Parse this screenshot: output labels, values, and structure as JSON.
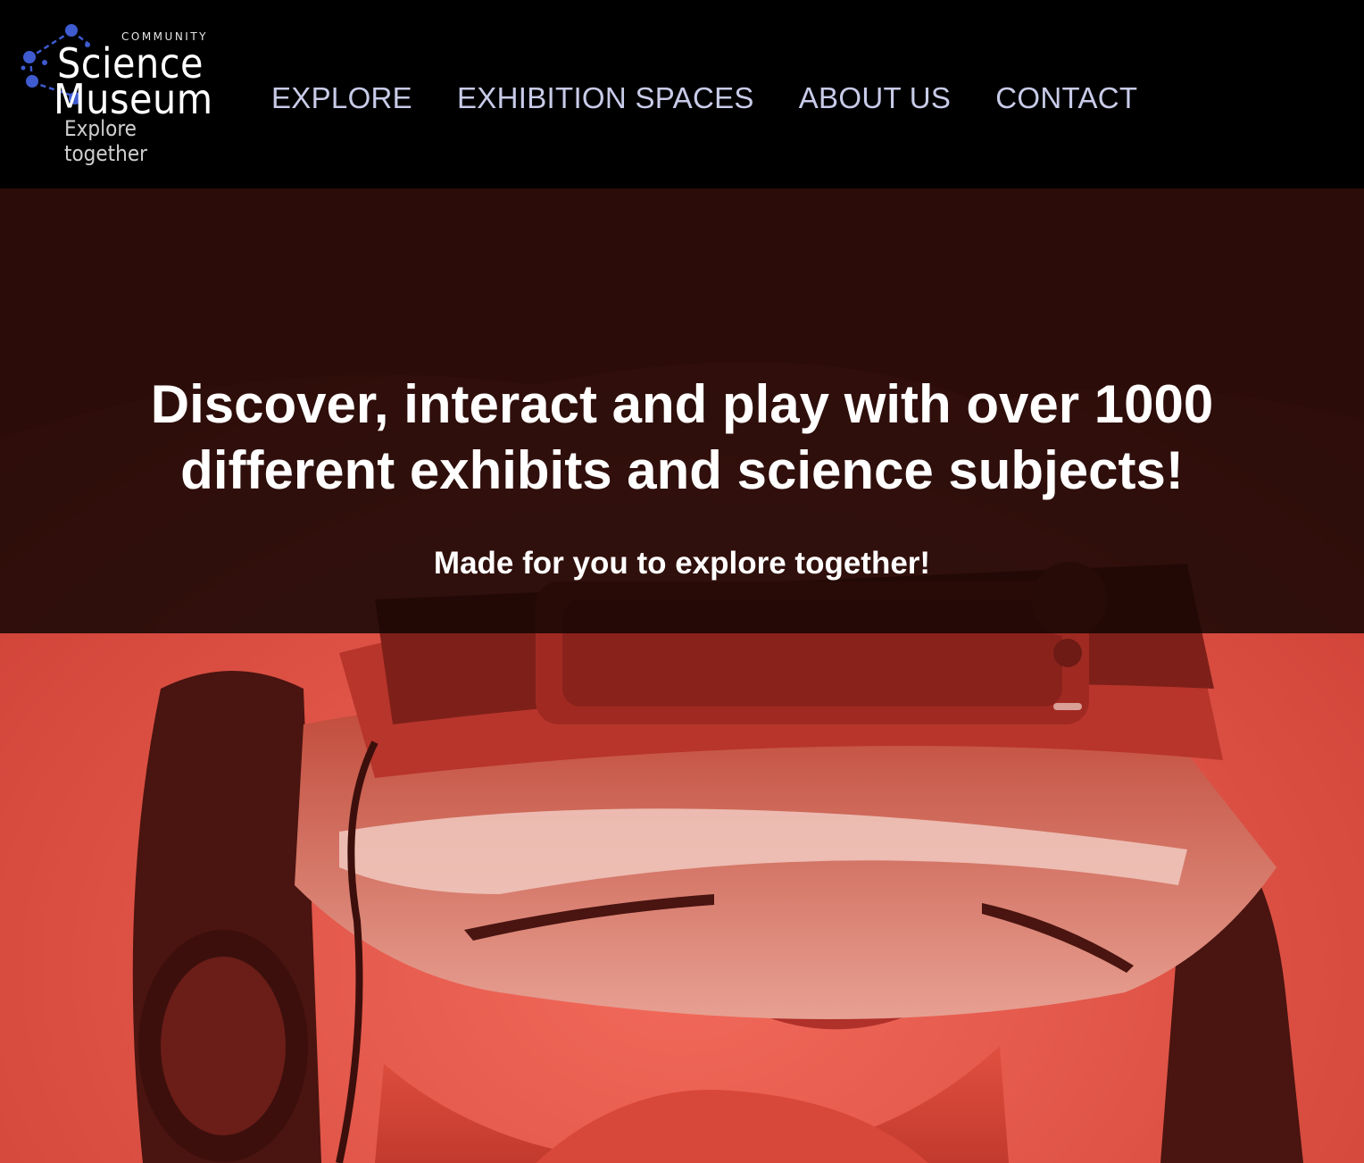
{
  "logo": {
    "line1": "COMMUNITY",
    "line2": "Science",
    "line3": "Museum",
    "tagline": "Explore together",
    "accent_color": "#3f5bd0"
  },
  "nav": {
    "items": [
      {
        "label": "EXPLORE"
      },
      {
        "label": "EXHIBITION SPACES"
      },
      {
        "label": "ABOUT US"
      },
      {
        "label": "CONTACT"
      }
    ],
    "link_color": "#c8cbe8"
  },
  "hero": {
    "title": "Discover, interact and play with over 1000 different exhibits and science subjects!",
    "subtitle": "Made for you to explore together!",
    "image_subject": "person-wearing-vr-headset-and-headphones",
    "tint_color": "#e8574a",
    "overlay_color": "#140604"
  }
}
